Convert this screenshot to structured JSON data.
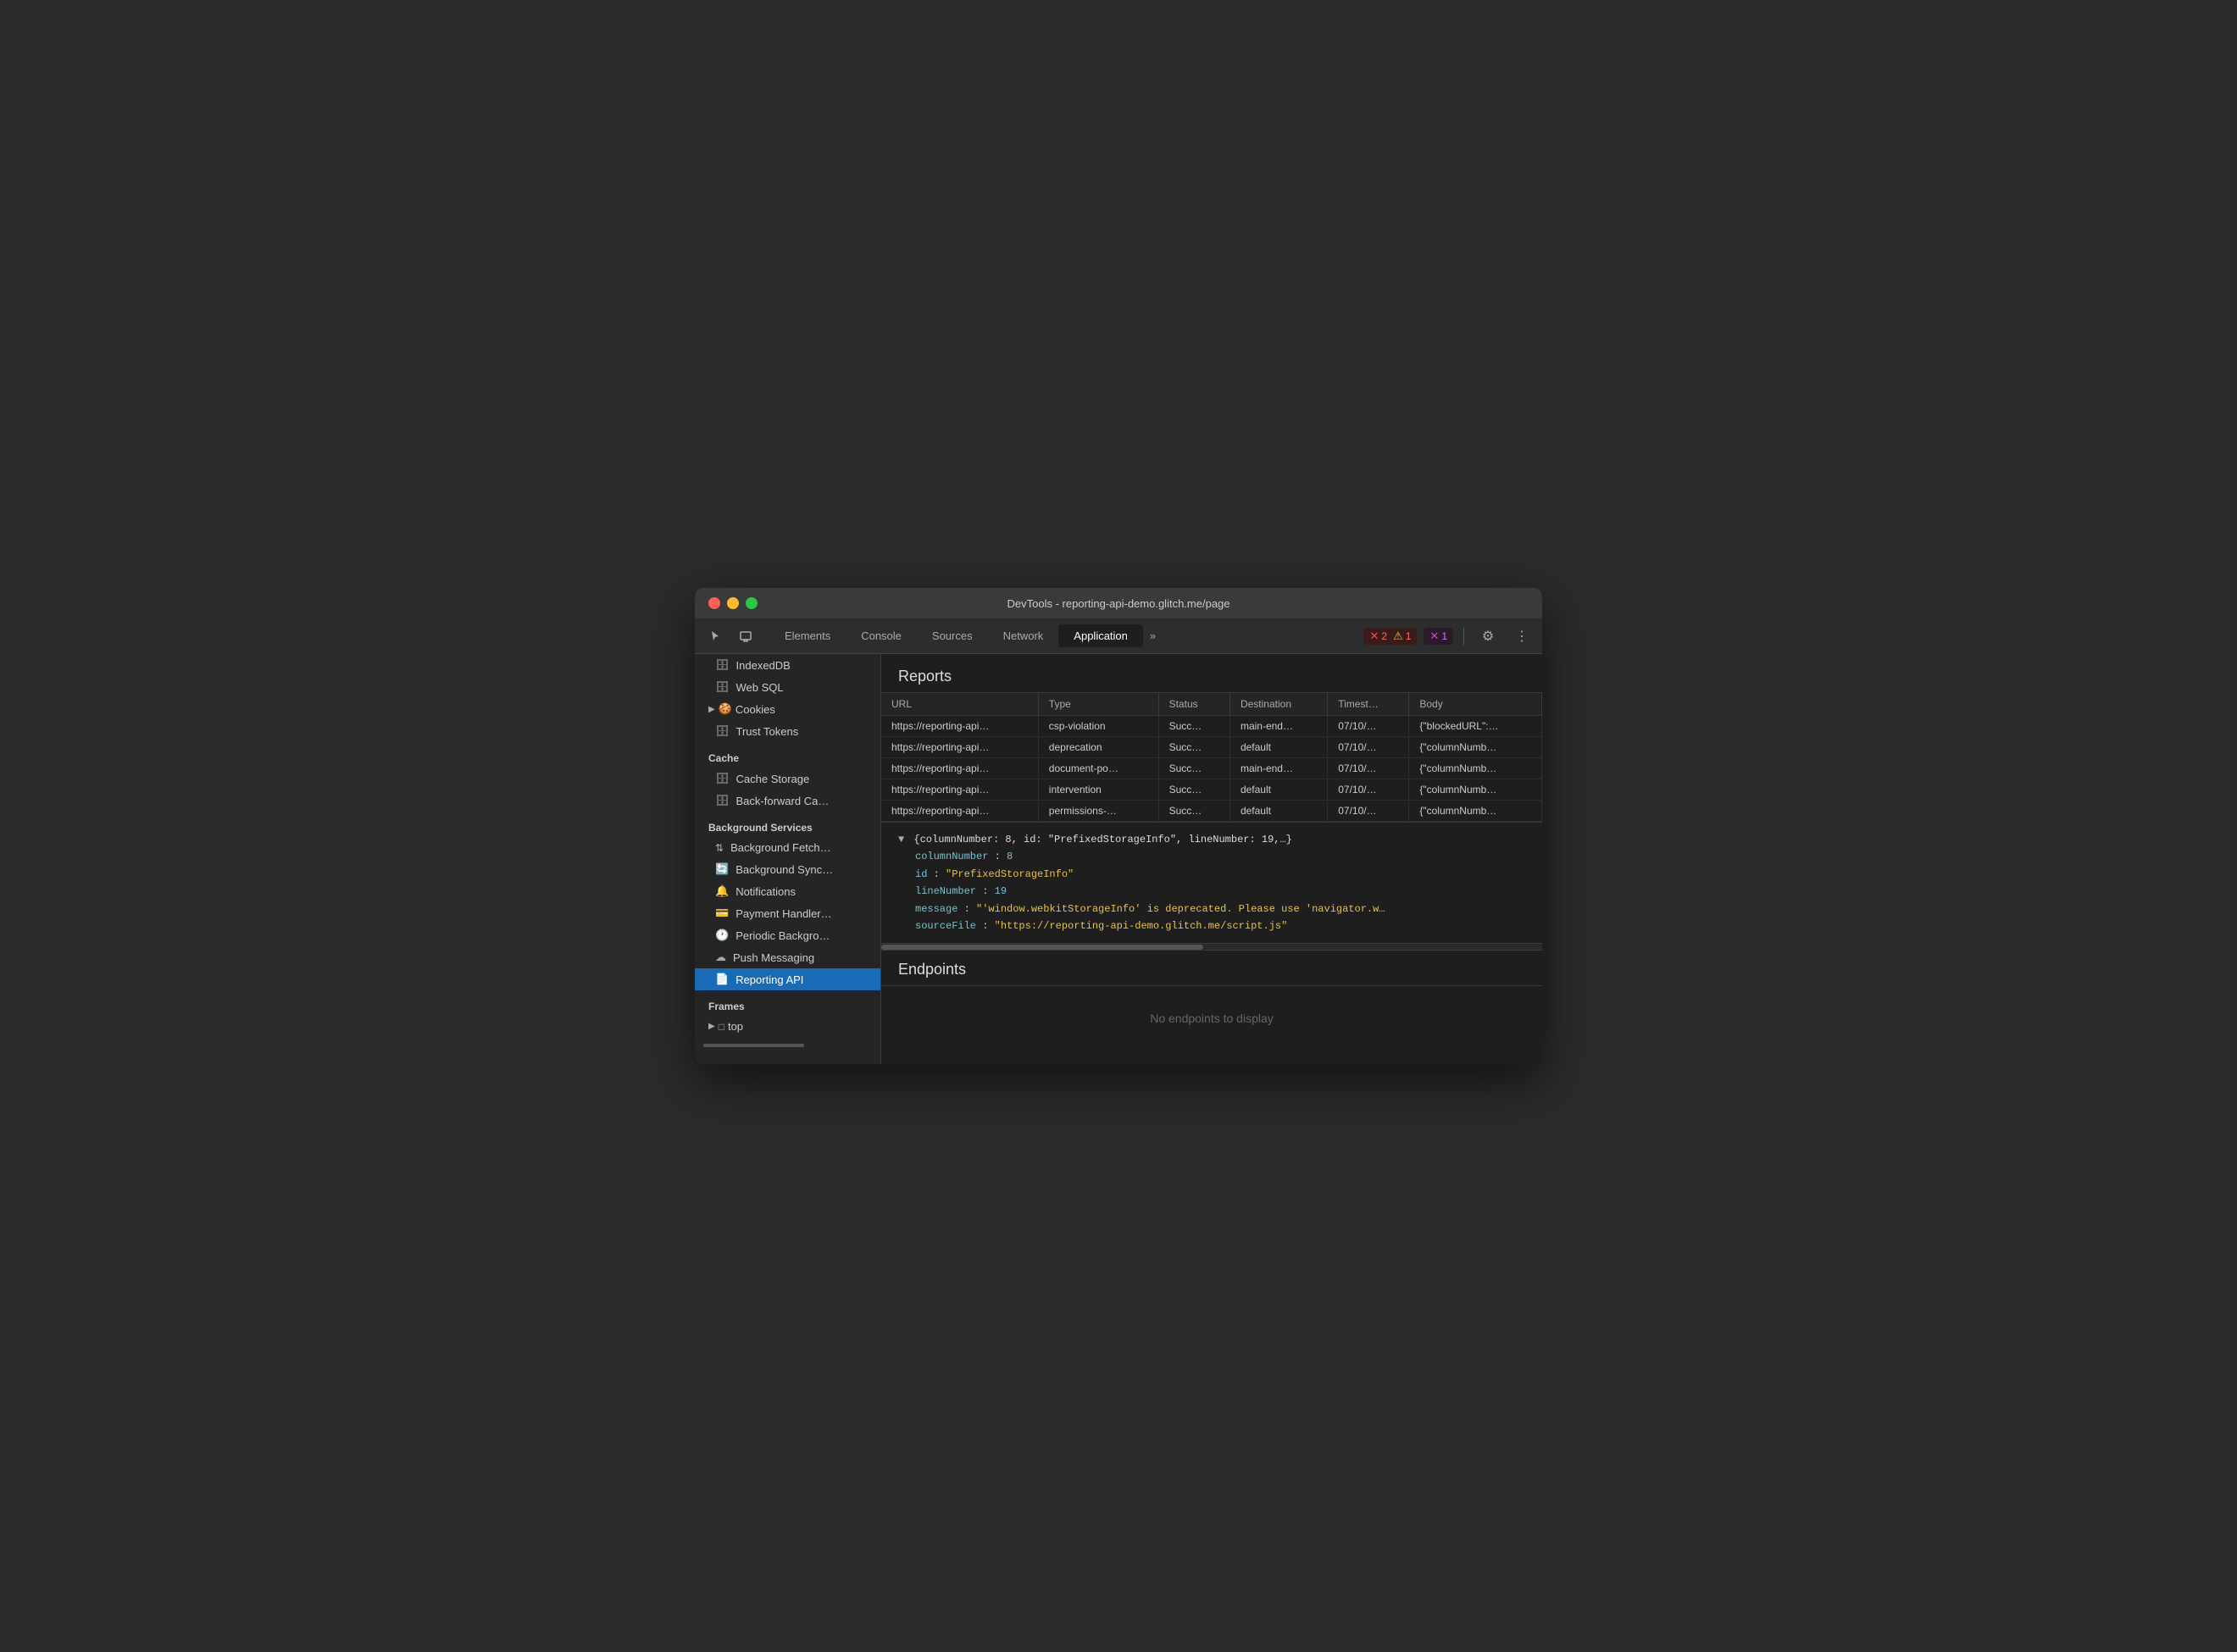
{
  "window": {
    "title": "DevTools - reporting-api-demo.glitch.me/page"
  },
  "toolbar": {
    "tabs": [
      {
        "id": "elements",
        "label": "Elements",
        "active": false
      },
      {
        "id": "console",
        "label": "Console",
        "active": false
      },
      {
        "id": "sources",
        "label": "Sources",
        "active": false
      },
      {
        "id": "network",
        "label": "Network",
        "active": false
      },
      {
        "id": "application",
        "label": "Application",
        "active": true
      }
    ],
    "more_label": "»",
    "error_count": "2",
    "warn_count": "1",
    "log_count": "1",
    "settings_icon": "⚙",
    "more_icon": "⋮"
  },
  "sidebar": {
    "cache_section": "Cache",
    "bg_section": "Background Services",
    "frames_section": "Frames",
    "items": [
      {
        "id": "indexeddb",
        "label": "IndexedDB",
        "icon": "🗄"
      },
      {
        "id": "websql",
        "label": "Web SQL",
        "icon": "🗄"
      },
      {
        "id": "cookies",
        "label": "Cookies",
        "icon": "🍪",
        "has_arrow": true
      },
      {
        "id": "trust-tokens",
        "label": "Trust Tokens",
        "icon": "🗄"
      },
      {
        "id": "cache-storage",
        "label": "Cache Storage",
        "icon": "🗄"
      },
      {
        "id": "back-forward",
        "label": "Back-forward Ca…",
        "icon": "🗄"
      },
      {
        "id": "bg-fetch",
        "label": "Background Fetch…",
        "icon": "↑↓"
      },
      {
        "id": "bg-sync",
        "label": "Background Sync…",
        "icon": "🔄"
      },
      {
        "id": "notifications",
        "label": "Notifications",
        "icon": "🔔"
      },
      {
        "id": "payment-handler",
        "label": "Payment Handler…",
        "icon": "💳"
      },
      {
        "id": "periodic-bg",
        "label": "Periodic Backgro…",
        "icon": "🕐"
      },
      {
        "id": "push-messaging",
        "label": "Push Messaging",
        "icon": "☁"
      },
      {
        "id": "reporting-api",
        "label": "Reporting API",
        "icon": "📄",
        "active": true
      },
      {
        "id": "frames-top",
        "label": "top",
        "icon": "□",
        "has_arrow": true,
        "section": "frames"
      }
    ]
  },
  "reports": {
    "title": "Reports",
    "columns": [
      "URL",
      "Type",
      "Status",
      "Destination",
      "Timest…",
      "Body"
    ],
    "rows": [
      {
        "url": "https://reporting-api…",
        "type": "csp-violation",
        "status": "Succ…",
        "destination": "main-end…",
        "timestamp": "07/10/…",
        "body": "{\"blockedURL\":…"
      },
      {
        "url": "https://reporting-api…",
        "type": "deprecation",
        "status": "Succ…",
        "destination": "default",
        "timestamp": "07/10/…",
        "body": "{\"columnNumb…"
      },
      {
        "url": "https://reporting-api…",
        "type": "document-po…",
        "status": "Succ…",
        "destination": "main-end…",
        "timestamp": "07/10/…",
        "body": "{\"columnNumb…"
      },
      {
        "url": "https://reporting-api…",
        "type": "intervention",
        "status": "Succ…",
        "destination": "default",
        "timestamp": "07/10/…",
        "body": "{\"columnNumb…"
      },
      {
        "url": "https://reporting-api…",
        "type": "permissions-…",
        "status": "Succ…",
        "destination": "default",
        "timestamp": "07/10/…",
        "body": "{\"columnNumb…"
      }
    ],
    "detail": {
      "summary": "{columnNumber: 8, id: \"PrefixedStorageInfo\", lineNumber: 19,…}",
      "fields": [
        {
          "key": "columnNumber",
          "value": "8",
          "type": "num"
        },
        {
          "key": "id",
          "value": "\"PrefixedStorageInfo\"",
          "type": "str"
        },
        {
          "key": "lineNumber",
          "value": "19",
          "type": "num"
        },
        {
          "key": "message",
          "value": "\"'window.webkitStorageInfo' is deprecated. Please use 'navigator.w…",
          "type": "str"
        },
        {
          "key": "sourceFile",
          "value": "\"https://reporting-api-demo.glitch.me/script.js\"",
          "type": "str"
        }
      ]
    }
  },
  "endpoints": {
    "title": "Endpoints",
    "empty_text": "No endpoints to display"
  }
}
